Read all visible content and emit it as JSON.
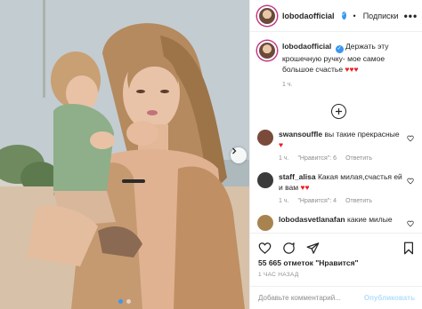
{
  "post": {
    "username": "lobodaofficial",
    "separator": "•",
    "follow_label": "Подписки",
    "more_label": "•••",
    "caption_text": "Держать эту крошечную ручку- мое самое большое счастье",
    "caption_hearts": "♥♥♥",
    "caption_time": "1 ч.",
    "likes": "55 665 отметок \"Нравится\"",
    "date": "1 ЧАС НАЗАД"
  },
  "comments": [
    {
      "username": "swansouffle",
      "text": "вы такие прекрасные",
      "hearts": "♥",
      "time": "1 ч.",
      "likes": "\"Нравится\": 6",
      "reply": "Ответить",
      "avatar_color": "#7a4b3a"
    },
    {
      "username": "staff_alisa",
      "text": "Какая милая,счастья ей и вам",
      "hearts": "♥♥",
      "time": "1 ч.",
      "likes": "\"Нравится\": 4",
      "reply": "Ответить",
      "avatar_color": "#3b3b3b"
    },
    {
      "username": "lobodasvetlanafan",
      "text": "какие милые",
      "hearts": "",
      "time": "",
      "likes": "",
      "reply": "",
      "avatar_color": "#a9834f"
    }
  ],
  "add_comment": {
    "placeholder": "Добавьте комментарий...",
    "publish_label": "Опубликовать"
  },
  "icons": {
    "next": "chevron-right-icon",
    "verified": "verified-badge-icon",
    "load_more": "plus-circle-icon",
    "like": "heart-icon",
    "comment": "comment-icon",
    "share": "paper-plane-icon",
    "save": "bookmark-icon"
  },
  "colors": {
    "verified_blue": "#3897f0",
    "heart_red": "#ed1c24",
    "muted_text": "#8e8e8e",
    "publish_disabled": "#b2dffc"
  },
  "carousel": {
    "slide_count": 2,
    "active_index": 0
  }
}
